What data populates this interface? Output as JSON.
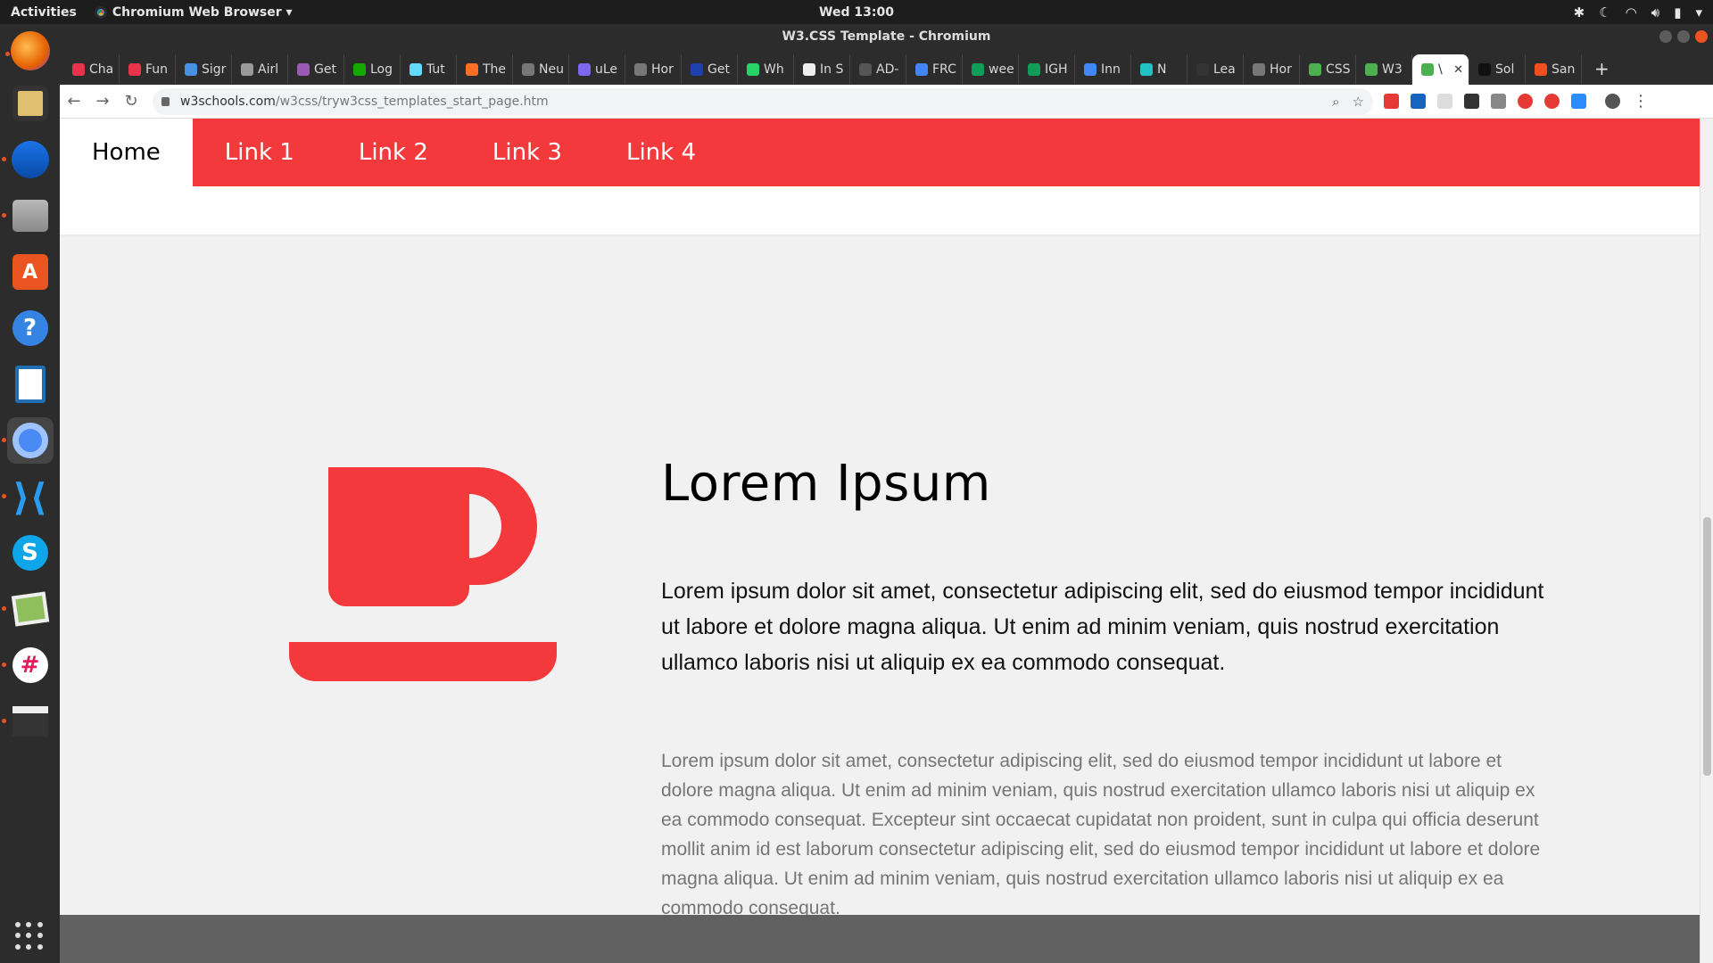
{
  "desktop": {
    "activities_label": "Activities",
    "app_menu_label": "Chromium Web Browser ▾",
    "clock": "Wed 13:00"
  },
  "dock": {
    "items": [
      "firefox-icon",
      "rhythmbox-icon",
      "thunderbird-icon",
      "files-icon",
      "software-center-icon",
      "help-icon",
      "writer-icon",
      "chromium-icon",
      "vscode-icon",
      "skype-icon",
      "image-viewer-icon",
      "slack-icon",
      "video-editor-icon"
    ]
  },
  "window": {
    "title": "W3.CSS Template - Chromium"
  },
  "tabs": [
    {
      "label": "Cha",
      "color": "#e8334a"
    },
    {
      "label": "Fun",
      "color": "#e8334a"
    },
    {
      "label": "Sigr",
      "color": "#4a90e2"
    },
    {
      "label": "Airl",
      "color": "#999999"
    },
    {
      "label": "Get",
      "color": "#9b59b6"
    },
    {
      "label": "Log",
      "color": "#14a800"
    },
    {
      "label": "Tut",
      "color": "#61dafb"
    },
    {
      "label": "The",
      "color": "#fc6d26"
    },
    {
      "label": "Neu",
      "color": "#777777"
    },
    {
      "label": "uLe",
      "color": "#7b68ee"
    },
    {
      "label": "Hor",
      "color": "#777777"
    },
    {
      "label": "Get",
      "color": "#1e40af"
    },
    {
      "label": "Wh",
      "color": "#25d366"
    },
    {
      "label": "In S",
      "color": "#eeeeee"
    },
    {
      "label": "AD-",
      "color": "#555555"
    },
    {
      "label": "FRC",
      "color": "#4285f4"
    },
    {
      "label": "wee",
      "color": "#0f9d58"
    },
    {
      "label": "IGH",
      "color": "#0f9d58"
    },
    {
      "label": "Inn",
      "color": "#4285f4"
    },
    {
      "label": "N",
      "color": "#22c1c3"
    },
    {
      "label": "Lea",
      "color": "#333333"
    },
    {
      "label": "Hor",
      "color": "#777777"
    },
    {
      "label": "CSS",
      "color": "#4caf50"
    },
    {
      "label": "W3",
      "color": "#4caf50"
    },
    {
      "label": "\\",
      "color": "#4caf50",
      "active": true
    },
    {
      "label": "Sol",
      "color": "#111111"
    },
    {
      "label": "San",
      "color": "#f24e1e"
    }
  ],
  "toolbar": {
    "url_domain": "w3schools.com",
    "url_path": "/w3css/tryw3css_templates_start_page.htm"
  },
  "page": {
    "nav": [
      "Home",
      "Link 1",
      "Link 2",
      "Link 3",
      "Link 4"
    ],
    "heading": "Lorem Ipsum",
    "lead": "Lorem ipsum dolor sit amet, consectetur adipiscing elit, sed do eiusmod tempor incididunt ut labore et dolore magna aliqua. Ut enim ad minim veniam, quis nostrud exercitation ullamco laboris nisi ut aliquip ex ea commodo consequat.",
    "body": "Lorem ipsum dolor sit amet, consectetur adipiscing elit, sed do eiusmod tempor incididunt ut labore et dolore magna aliqua. Ut enim ad minim veniam, quis nostrud exercitation ullamco laboris nisi ut aliquip ex ea commodo consequat. Excepteur sint occaecat cupidatat non proident, sunt in culpa qui officia deserunt mollit anim id est laborum consectetur adipiscing elit, sed do eiusmod tempor incididunt ut labore et dolore magna aliqua. Ut enim ad minim veniam, quis nostrud exercitation ullamco laboris nisi ut aliquip ex ea commodo consequat.",
    "accent_color": "#f4393c",
    "icon": "coffee-cup-icon"
  }
}
